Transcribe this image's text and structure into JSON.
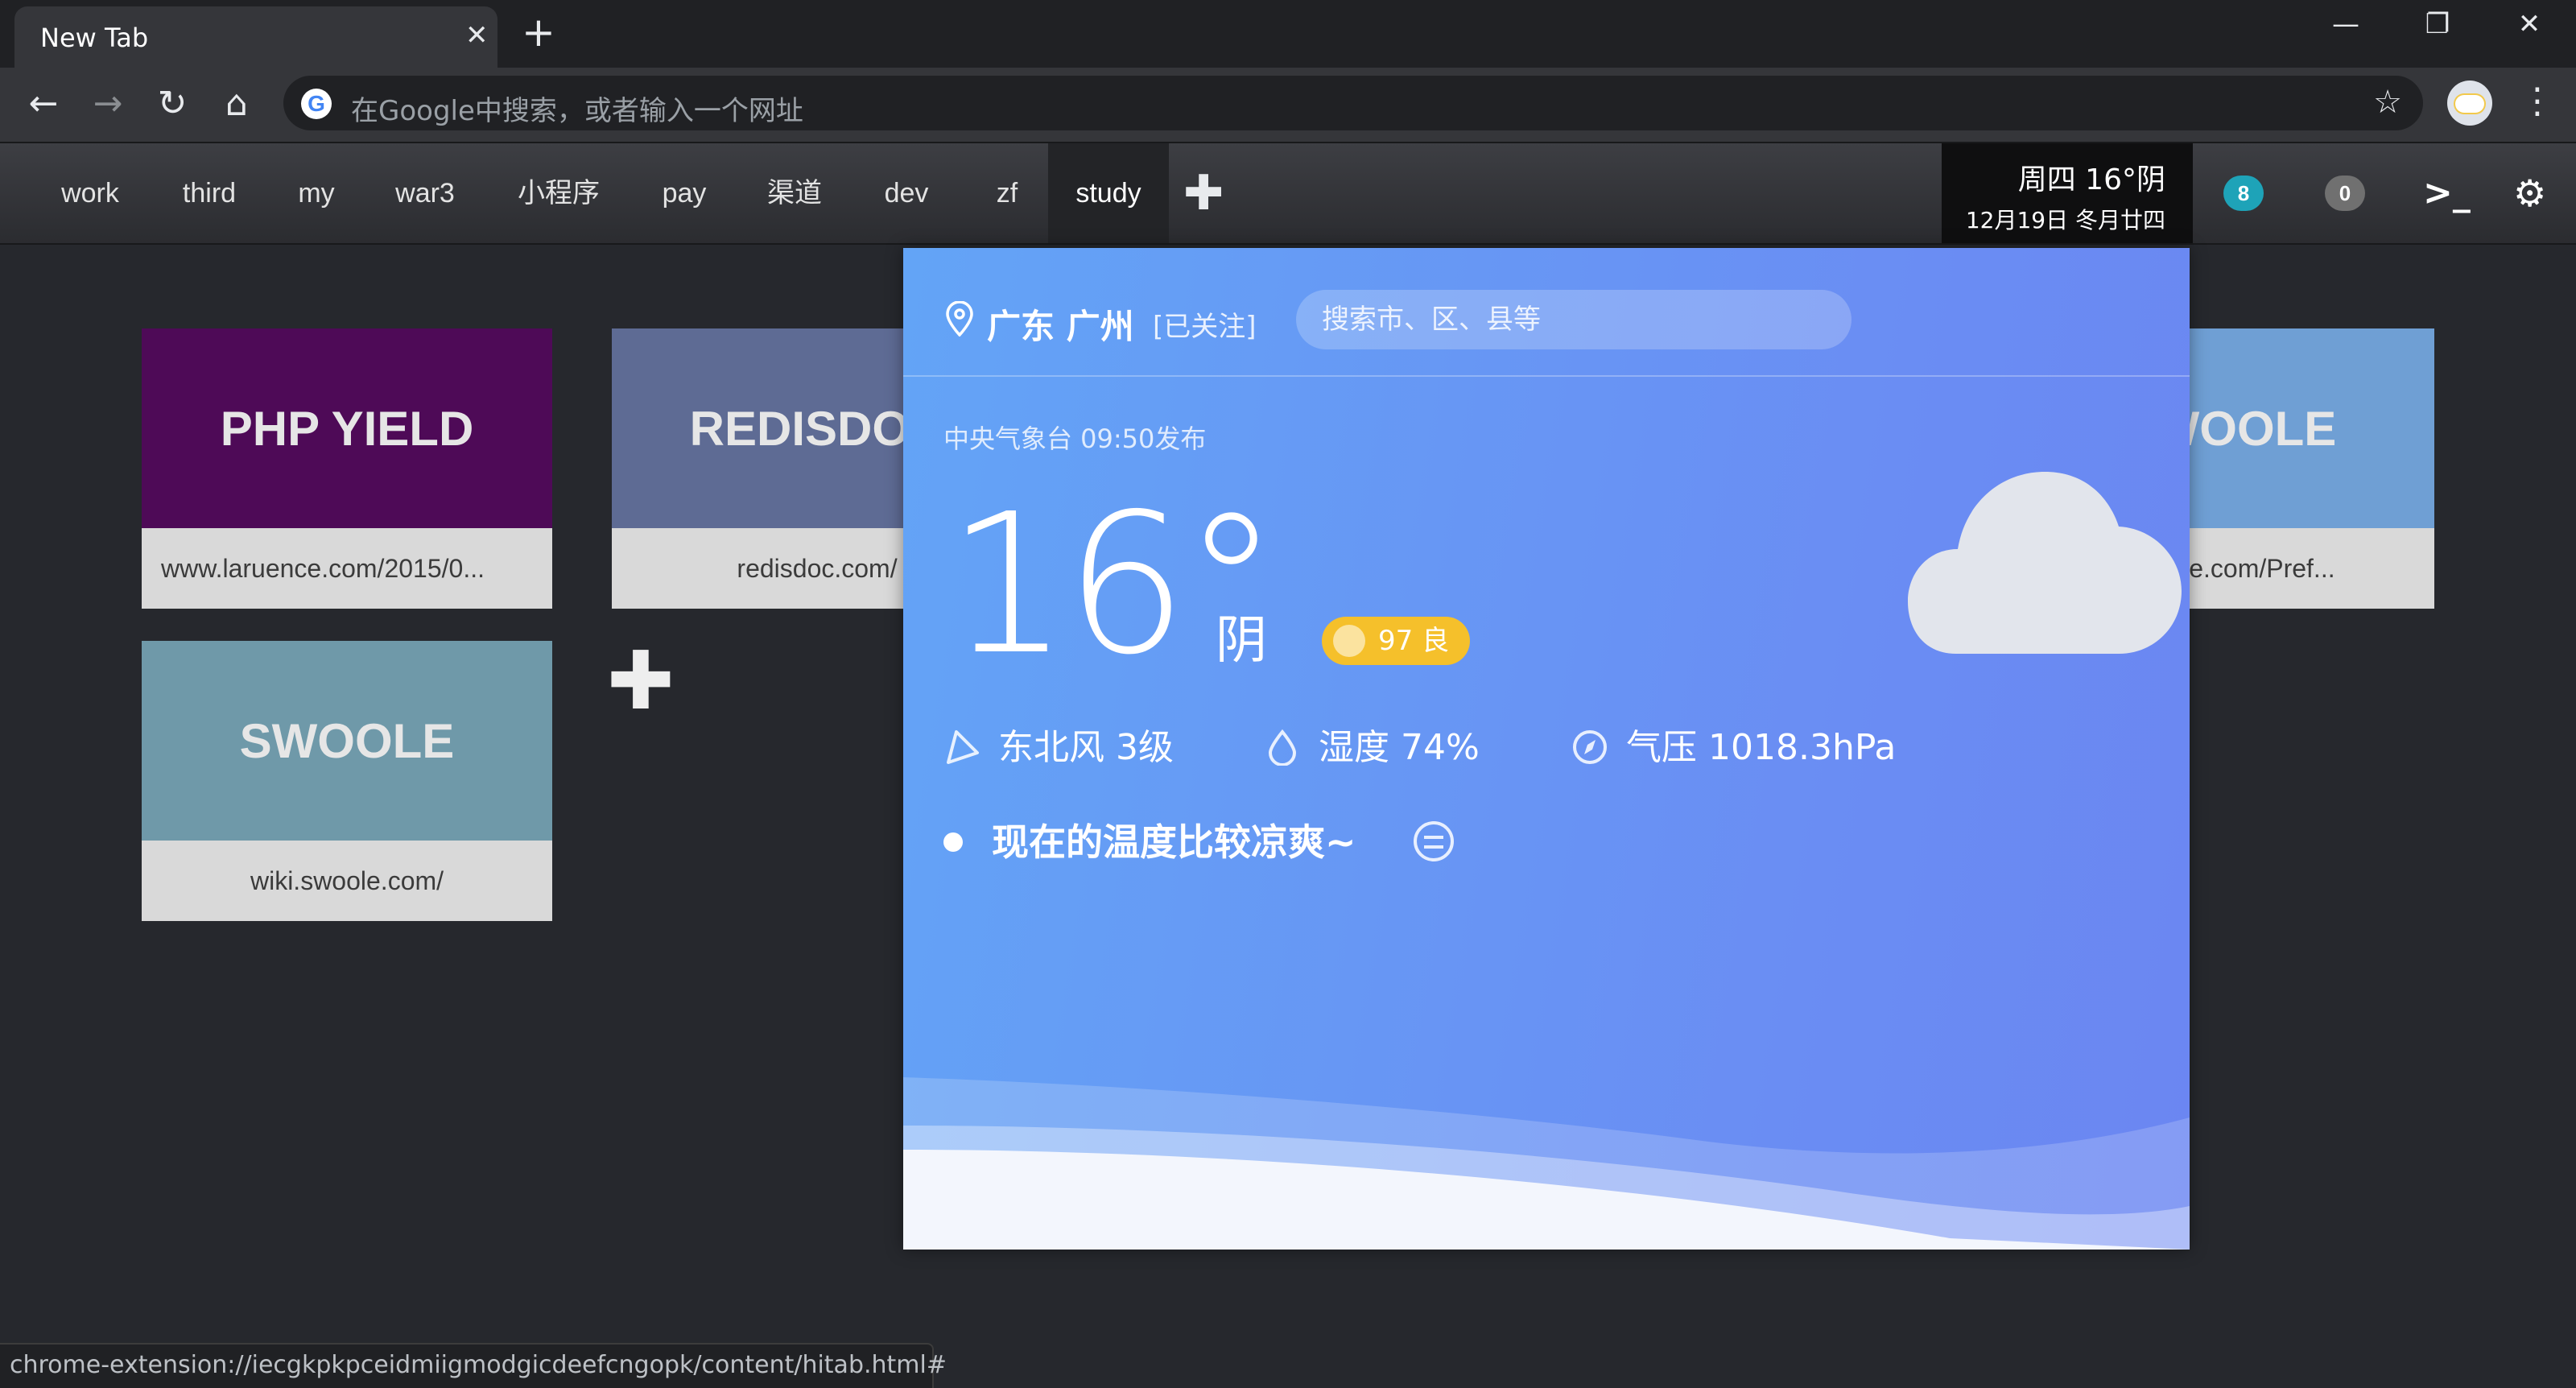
{
  "tab": {
    "title": "New Tab",
    "close": "✕",
    "new_tab": "+"
  },
  "window": {
    "minimize": "—",
    "restore": "❐",
    "close": "✕"
  },
  "toolbar": {
    "back": "←",
    "forward": "→",
    "reload": "↻",
    "home": "⌂",
    "google_glyph": "G",
    "omnibox_placeholder": "在Google中搜索，或者输入一个网址",
    "star": "☆",
    "menu": "⋮"
  },
  "nav": {
    "items": [
      "work",
      "third",
      "my",
      "war3",
      "小程序",
      "pay",
      "渠道",
      "dev",
      "zf",
      "study"
    ],
    "active": "study",
    "add": "✚",
    "date_line1": "周四 16°阴",
    "date_line2": "12月19日 冬月廿四",
    "badge_count_1": "8",
    "badge_count_2": "0",
    "badge_colors": [
      "#1ea3b8",
      "#707070"
    ],
    "terminal_icon": ">_",
    "settings_icon": "⚙"
  },
  "tiles": [
    {
      "title": "PHP YIELD",
      "url": "www.laruence.com/2015/0...",
      "color": "#4e0a57"
    },
    {
      "title": "REDISDOC",
      "url": "redisdoc.com/",
      "color": "#5e6b94"
    },
    {
      "title": "SWOOLE",
      "url": "swoole.com/Pref...",
      "color": "#6f9fd4"
    },
    {
      "title": "SWOOLE",
      "url": "wiki.swoole.com/",
      "color": "#6f99a9"
    }
  ],
  "add_tile": "✚",
  "weather": {
    "city": "广东 广州",
    "follow": "[已关注]",
    "search_placeholder": "搜索市、区、县等",
    "source": "中央气象台 09:50发布",
    "temp": "16°",
    "condition": "阴",
    "aqi": "97 良",
    "wind": "东北风 3级",
    "humidity": "湿度 74%",
    "pressure": "气压 1018.3hPa",
    "tip": "现在的温度比较凉爽~",
    "colors": {
      "aqi": "#f5c02b",
      "gradient_start": "#63a4f6",
      "gradient_end": "#6b86f2"
    }
  },
  "status": {
    "url": "chrome-extension://iecgkpkpceidmiigmodgicdeefcngopk/content/hitab.html#"
  }
}
